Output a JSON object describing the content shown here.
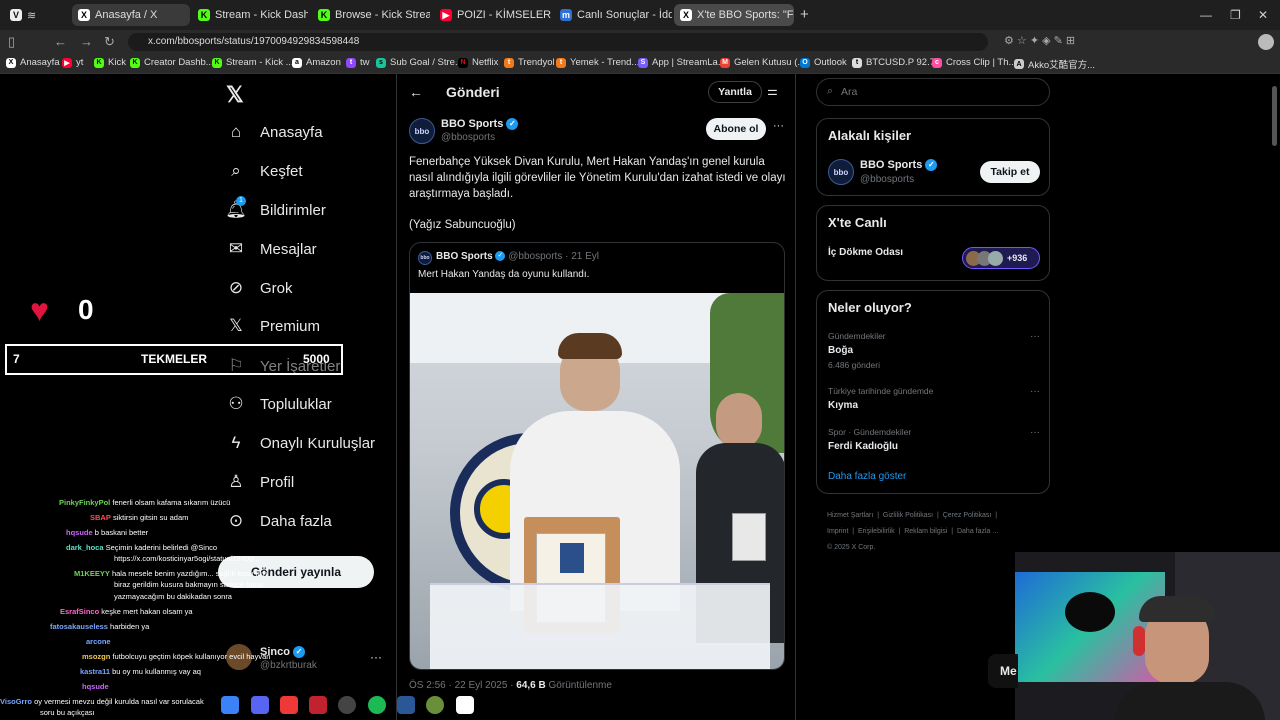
{
  "browser": {
    "tabs": [
      {
        "label": "Anasayfa / X",
        "icon": "x"
      },
      {
        "label": "Stream - Kick Dashboard",
        "icon": "kick"
      },
      {
        "label": "Browse - Kick Streaming",
        "icon": "kick"
      },
      {
        "label": "POIZI - KİMSELER DUYMAS",
        "icon": "youtube"
      },
      {
        "label": "Canlı Sonuçlar - İddaa Sonu",
        "icon": "mackolik"
      },
      {
        "label": "X'te BBO Sports: \"Fenerbah",
        "icon": "x"
      }
    ],
    "url": "x.com/bbosports/status/1970094929834598448",
    "bookmarks": [
      "Anasayfa",
      "yt",
      "Kick",
      "Creator Dashb...",
      "Stream - Kick ...",
      "Amazon",
      "tw",
      "Sub Goal / Stre...",
      "Netflix",
      "Trendyol",
      "Yemek - Trend...",
      "App | StreamLa...",
      "Gelen Kutusu (...",
      "Outlook",
      "BTCUSD.P 92.7...",
      "Cross Clip | Th...",
      "Akko艾酷官方..."
    ]
  },
  "nav": {
    "items": [
      {
        "label": "Anasayfa",
        "icon": "home-icon"
      },
      {
        "label": "Keşfet",
        "icon": "search-icon"
      },
      {
        "label": "Bildirimler",
        "icon": "bell-icon",
        "badge": "1"
      },
      {
        "label": "Mesajlar",
        "icon": "mail-icon"
      },
      {
        "label": "Grok",
        "icon": "grok-icon"
      },
      {
        "label": "Premium",
        "icon": "x-icon"
      },
      {
        "label": "Yer İşaretleri",
        "icon": "bookmark-icon"
      },
      {
        "label": "Topluluklar",
        "icon": "people-icon"
      },
      {
        "label": "Onaylı Kuruluşlar",
        "icon": "bolt-icon"
      },
      {
        "label": "Profil",
        "icon": "user-icon"
      },
      {
        "label": "Daha fazla",
        "icon": "more-icon"
      }
    ],
    "post_button": "Gönderi yayınla",
    "account": {
      "name": "Sinco",
      "handle": "@bzkrtburak"
    }
  },
  "post": {
    "header_title": "Gönderi",
    "reply_label": "Yanıtla",
    "author_name": "BBO Sports",
    "author_handle": "@bbosports",
    "follow_label": "Abone ol",
    "text": "Fenerbahçe Yüksek Divan Kurulu, Mert Hakan Yandaş'ın genel kurula nasıl alındığıyla ilgili görevliler ile Yönetim Kurulu'dan izahat istedi ve olayı araştırmaya başladı.",
    "credit": "(Yağız Sabuncuoğlu)",
    "quote": {
      "author_name": "BBO Sports",
      "author_meta": "@bbosports · 21 Eyl",
      "text": "Mert Hakan Yandaş da oyunu kullandı."
    },
    "timestamp": "ÖS 2:56 · 22 Eyl 2025 · ",
    "views": "64,6 B",
    "views_label": " Görüntülenme"
  },
  "right": {
    "search_placeholder": "Ara",
    "who_title": "Alakalı kişiler",
    "who": {
      "name": "BBO Sports",
      "handle": "@bbosports",
      "follow_label": "Takip et"
    },
    "live_title": "X'te Canlı",
    "live_room": "İç Dökme Odası",
    "live_count": "+936",
    "trends_title": "Neler oluyor?",
    "trends": [
      {
        "context": "Gündemdekiler",
        "name": "Boğa",
        "count": "6.486 gönderi"
      },
      {
        "context": "Türkiye tarihinde gündemde",
        "name": "Kıyma",
        "count": ""
      },
      {
        "context": "Spor · Gündemdekiler",
        "name": "Ferdi Kadıoğlu",
        "count": ""
      }
    ],
    "show_more": "Daha fazla göster",
    "footer": [
      "Hizmet Şartları",
      "|",
      "Gizlilik Politikası",
      "|",
      "Çerez Politikası",
      "|",
      "Imprint",
      "|",
      "Erişilebilirlik",
      "|",
      "Reklam bilgisi",
      "|",
      "Daha fazla ...",
      "© 2025 X Corp."
    ]
  },
  "overlay": {
    "heart_count": "0",
    "kick_bar": {
      "left": "7",
      "label": "TEKMELER",
      "right": "5000"
    },
    "chat": [
      {
        "user": "PinkyFinkyPol",
        "color": "#6fd35a",
        "msg": "fenerli olsam kafama sıkarım üzücü"
      },
      {
        "user": "SBAP",
        "color": "#ff4d4d",
        "msg": "siktirsin gitsin su adam"
      },
      {
        "user": "hqsude",
        "color": "#cc66ff",
        "msg": "b baskani better"
      },
      {
        "user": "dark_hoca",
        "color": "#5ee0c8",
        "msg": "Seçimin kaderini belirledi @Sinco"
      },
      {
        "user": "",
        "color": "#ffffff",
        "msg": "https://x.com/kosticinyar5ogi/status/19700..."
      },
      {
        "user": "M1KEEYY",
        "color": "#6fd35a",
        "msg": "hala mesele benim yazdığım... sağlık kosu fikri"
      },
      {
        "user": "",
        "color": "#ffffff",
        "msg": "biraz gerildim kusura bakmayın sadece bunu"
      },
      {
        "user": "",
        "color": "#ffffff",
        "msg": "yazmayacağım bu dakikadan sonra"
      },
      {
        "user": "EsrafSinco",
        "color": "#ff66cc",
        "msg": "keşke mert hakan olsam ya"
      },
      {
        "user": "fatosakauseless",
        "color": "#7aa7ff",
        "msg": "harbiden ya"
      },
      {
        "user": "arcone",
        "color": "#7aa7ff",
        "msg": ""
      },
      {
        "user": "msozgn",
        "color": "#f2c94c",
        "msg": "futbolcuyu geçtim köpek kullanıyor evcil hayvan"
      },
      {
        "user": "kastra11",
        "color": "#7aa7ff",
        "msg": "bu oy mu kullanmış vay aq"
      },
      {
        "user": "hqsude",
        "color": "#cc66ff",
        "msg": ""
      },
      {
        "user": "VisoGrro",
        "color": "#7aa7ff",
        "msg": "oy vermesi mevzu değil kurulda nasıl var sorulacak"
      },
      {
        "user": "",
        "color": "#ffffff",
        "msg": "soru bu açıkçası"
      }
    ],
    "webcam_partial": "Me"
  }
}
